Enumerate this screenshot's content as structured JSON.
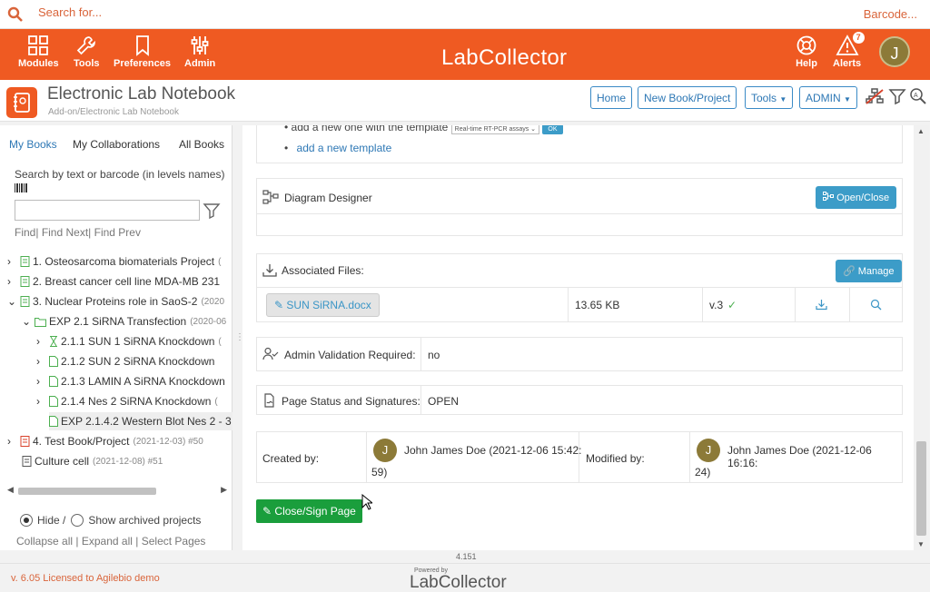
{
  "search": {
    "placeholder": "Search for...",
    "barcode_label": "Barcode..."
  },
  "nav": {
    "left": [
      {
        "label": "Modules",
        "icon": "grid-icon"
      },
      {
        "label": "Tools",
        "icon": "wrench-icon"
      },
      {
        "label": "Preferences",
        "icon": "bookmark-icon"
      },
      {
        "label": "Admin",
        "icon": "sliders-icon"
      }
    ],
    "logo_text_a": "Lab",
    "logo_text_b": "Collector",
    "help_label": "Help",
    "alerts_label": "Alerts",
    "alerts_count": "7",
    "user_initial": "J"
  },
  "header": {
    "title": "Electronic Lab Notebook",
    "breadcrumb": "Add-on/Electronic Lab Notebook",
    "buttons": {
      "home": "Home",
      "new_book": "New Book/Project",
      "tools": "Tools",
      "admin": "ADMIN"
    }
  },
  "sidebar": {
    "tabs": {
      "my_books": "My Books",
      "my_collab": "My Collaborations",
      "all_books": "All Books"
    },
    "search_label": "Search by text or barcode (in levels names)",
    "find": "Find|",
    "find_next": "Find Next|",
    "find_prev": "Find Prev",
    "tree": [
      {
        "label": "1. Osteosarcoma biomaterials Project",
        "meta": "(",
        "type": "book"
      },
      {
        "label": "2. Breast cancer cell line MDA-MB 231",
        "meta": "",
        "type": "book"
      },
      {
        "label": "3. Nuclear Proteins role in SaoS-2",
        "meta": "(2020",
        "type": "book"
      },
      {
        "label": "EXP 2.1 SiRNA Transfection",
        "meta": "(2020-06",
        "type": "folder"
      },
      {
        "label": "2.1.1 SUN 1 SiRNA Knockdown",
        "meta": "(",
        "type": "hourglass"
      },
      {
        "label": "2.1.2 SUN 2 SiRNA Knockdown",
        "meta": "",
        "type": "page"
      },
      {
        "label": "2.1.3 LAMIN A SiRNA Knockdown",
        "meta": "",
        "type": "page"
      },
      {
        "label": "2.1.4 Nes 2 SiRNA Knockdown",
        "meta": "(",
        "type": "page"
      },
      {
        "label": "EXP 2.1.4.2 Western Blot Nes 2 - 3",
        "meta": "",
        "type": "page"
      },
      {
        "label": "4. Test Book/Project",
        "meta": "(2021-12-03) #50",
        "type": "book-red"
      },
      {
        "label": "Culture cell",
        "meta": "(2021-12-08) #51",
        "type": "book-plain"
      }
    ],
    "hide_label": "Hide /",
    "show_archived": "Show archived projects",
    "collapse_all": "Collapse all",
    "expand_all": "Expand all",
    "select_pages": "Select Pages",
    "sep": "|"
  },
  "main": {
    "template_text": "add a new one with the template",
    "template_select": "Real-time RT-PCR assays",
    "template_ok": "OK",
    "add_template": "add a new template",
    "diagram_title": "Diagram Designer",
    "open_close": "Open/Close",
    "assoc_title": "Associated Files:",
    "manage": "Manage",
    "file": {
      "name": "SUN SiRNA.docx",
      "size": "13.65 KB",
      "version": "v.3",
      "check": "✓"
    },
    "admin_validation_label": "Admin Validation Required:",
    "admin_validation_value": "no",
    "page_status_label": "Page Status and Signatures:",
    "page_status_value": "OPEN",
    "created_label": "Created by:",
    "created_initial": "J",
    "created_by_a": "John James Doe (2021-12-06 15:42:",
    "created_by_b": "59)",
    "modified_label": "Modified by:",
    "modified_initial": "J",
    "modified_by_a": "John James Doe (2021-12-06 16:16:",
    "modified_by_b": "24)",
    "close_sign": "Close/Sign Page"
  },
  "version": "4.151",
  "footer": {
    "license": "v. 6.05 Licensed to Agilebio demo",
    "powered": "Powered by",
    "logo_a": "Lab",
    "logo_b": "Collector"
  },
  "colors": {
    "brand_orange": "#ef5a22",
    "link_blue": "#2e78b5",
    "button_blue": "#3c9cc8",
    "button_green": "#1a9e3c"
  }
}
